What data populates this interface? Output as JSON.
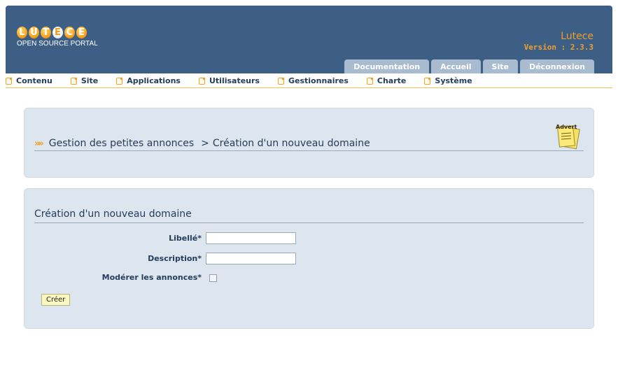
{
  "header": {
    "logo_letters": [
      "L",
      "U",
      "T",
      "E",
      "C",
      "E"
    ],
    "logo_subtitle": "OPEN SOURCE PORTAL",
    "brand_name": "Lutece",
    "version": "Version : 2.3.3",
    "tabs": [
      {
        "label": "Documentation"
      },
      {
        "label": "Accueil"
      },
      {
        "label": "Site"
      },
      {
        "label": "Déconnexion"
      }
    ]
  },
  "menu": {
    "items": [
      {
        "label": "Contenu"
      },
      {
        "label": "Site"
      },
      {
        "label": "Applications"
      },
      {
        "label": "Utilisateurs"
      },
      {
        "label": "Gestionnaires"
      },
      {
        "label": "Charte"
      },
      {
        "label": "Système"
      }
    ]
  },
  "breadcrumb": {
    "root": "Gestion des petites annonces",
    "separator": ">",
    "current": "Création d'un nouveau domaine"
  },
  "advert_icon": {
    "name": "advert-icon",
    "text": "Advert"
  },
  "form": {
    "title": "Création d'un nouveau domaine",
    "fields": {
      "label": {
        "label": "Libellé*",
        "value": ""
      },
      "description": {
        "label": "Description*",
        "value": ""
      },
      "moderate": {
        "label": "Modérer les annonces*",
        "checked": false
      }
    },
    "submit_label": "Créer"
  },
  "colors": {
    "header_bg": "#3d5f86",
    "tab_bg": "#a9bccf",
    "accent": "#f0a02a",
    "panel_bg": "#dde6ef",
    "text": "#233d5c"
  }
}
